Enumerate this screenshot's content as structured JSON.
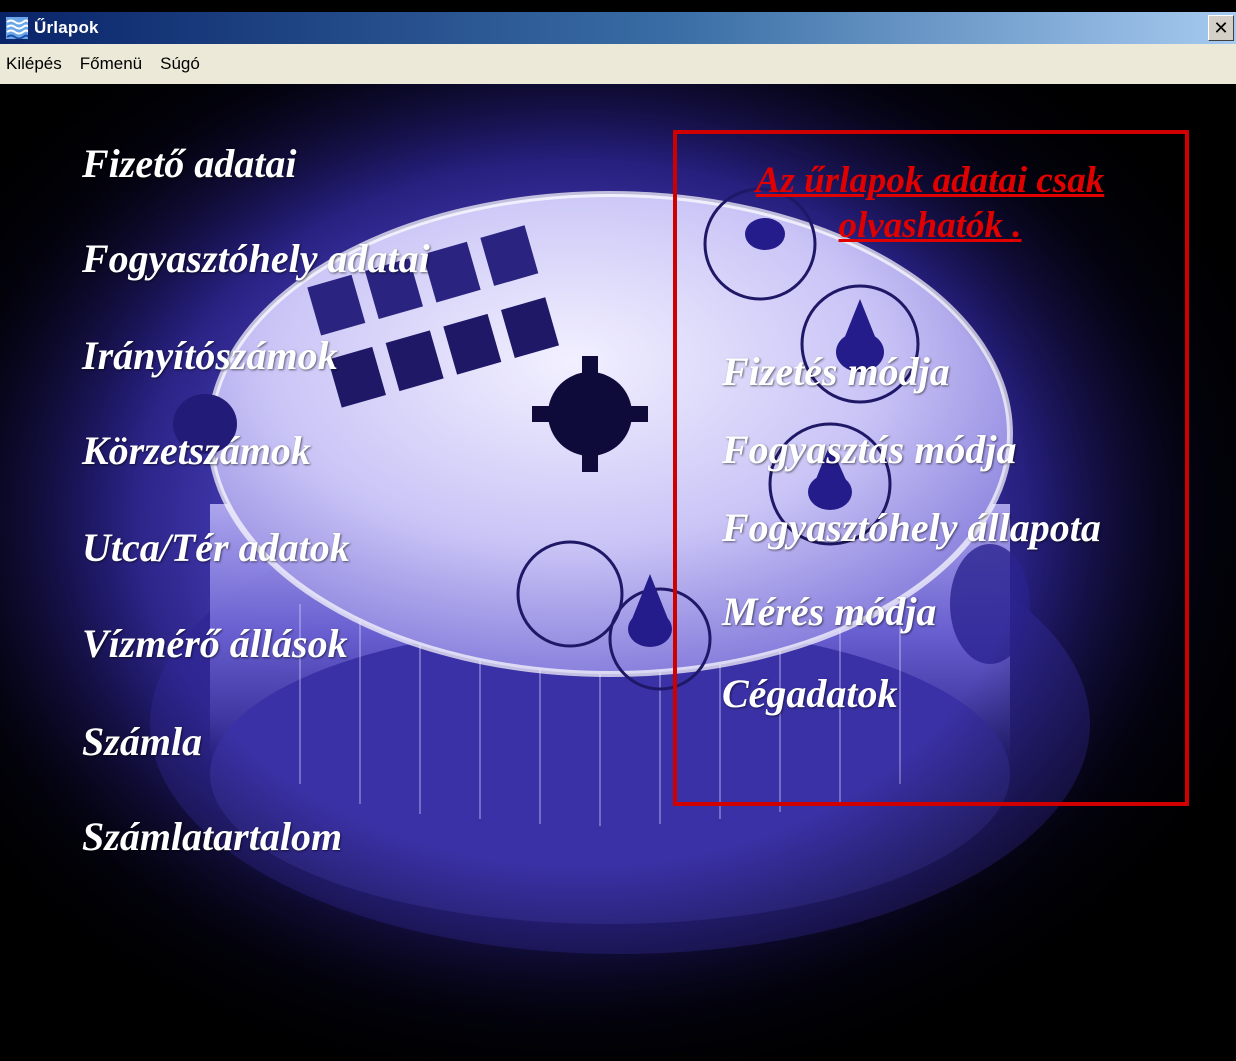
{
  "window": {
    "title": "Űrlapok",
    "close_symbol": "✕"
  },
  "menu": {
    "items": [
      {
        "label": "Kilépés"
      },
      {
        "label": "Főmenü"
      },
      {
        "label": "Súgó"
      }
    ]
  },
  "left_forms": [
    {
      "label": "Fizető adatai"
    },
    {
      "label": "Fogyasztóhely adatai"
    },
    {
      "label": "Irányítószámok"
    },
    {
      "label": "Körzetszámok"
    },
    {
      "label": "Utca/Tér adatok"
    },
    {
      "label": "Vízmérő állások"
    },
    {
      "label": "Számla"
    },
    {
      "label": "Számlatartalom"
    }
  ],
  "readonly_panel": {
    "note": "Az űrlapok adatai csak olvashatók .",
    "items": [
      {
        "label": "Fizetés módja"
      },
      {
        "label": "Fogyasztás módja"
      },
      {
        "label": "Fogyasztóhely állapota"
      },
      {
        "label": "Mérés módja"
      },
      {
        "label": "Cégadatok"
      }
    ]
  },
  "colors": {
    "titlebar_start": "#0a246a",
    "titlebar_end": "#a6caf0",
    "menubar": "#ece9d8",
    "background_tint": "#5a4fd8",
    "frame": "#d00000",
    "label": "#ffffff",
    "note": "#e00000"
  },
  "icons": {
    "window_icon": "water-waves-icon",
    "close": "close-icon"
  }
}
